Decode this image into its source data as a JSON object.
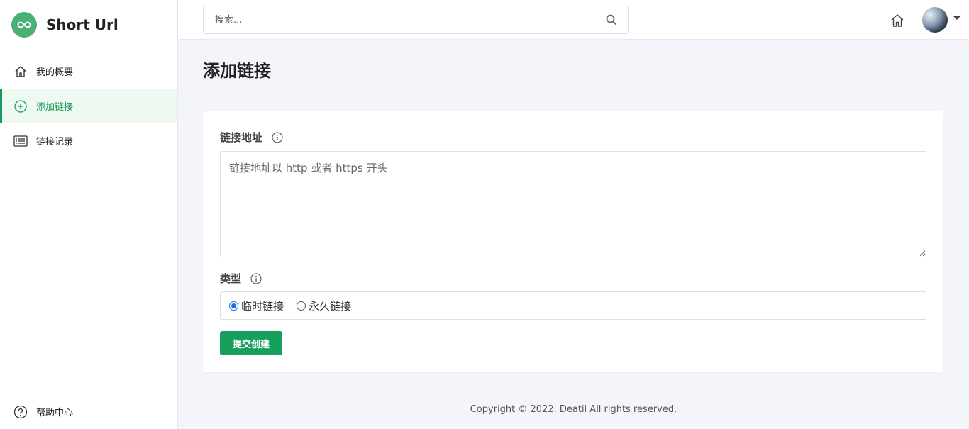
{
  "brand": {
    "name": "Short Url"
  },
  "sidebar": {
    "items": [
      {
        "label": "我的概要"
      },
      {
        "label": "添加链接"
      },
      {
        "label": "链接记录"
      }
    ],
    "help": {
      "label": "帮助中心"
    }
  },
  "topbar": {
    "search_placeholder": "搜索..."
  },
  "page": {
    "title": "添加链接"
  },
  "form": {
    "url_label": "链接地址",
    "url_placeholder": "链接地址以 http 或者 https 开头",
    "type_label": "类型",
    "type_options": [
      {
        "label": "临时链接",
        "selected": true
      },
      {
        "label": "永久链接",
        "selected": false
      }
    ],
    "submit_label": "提交创建"
  },
  "footer": {
    "text": "Copyright © 2022. Deatil All rights reserved."
  },
  "colors": {
    "accent": "#17a05d",
    "active_bg": "#edf9f1",
    "radio": "#1f6fe0"
  }
}
